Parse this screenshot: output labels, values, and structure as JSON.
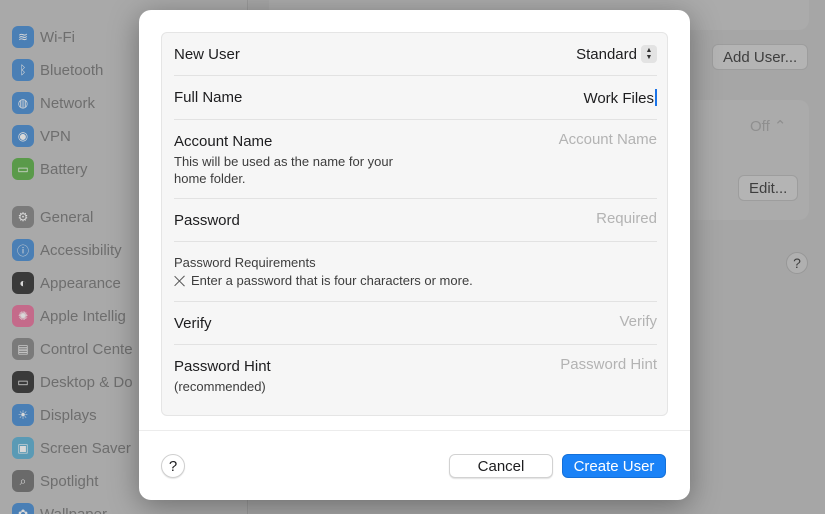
{
  "sidebar": {
    "items": [
      {
        "label": "Wi-Fi",
        "icon": "wifi-icon",
        "color": "#4a7fb5"
      },
      {
        "label": "Bluetooth",
        "icon": "bluetooth-icon",
        "color": "#4a7fb5"
      },
      {
        "label": "Network",
        "icon": "globe-icon",
        "color": "#4a7fb5"
      },
      {
        "label": "VPN",
        "icon": "vpn-icon",
        "color": "#4a7fb5"
      },
      {
        "label": "Battery",
        "icon": "battery-icon",
        "color": "#5a9a4a"
      },
      {
        "label": "General",
        "icon": "gear-icon",
        "color": "#7a7a7a"
      },
      {
        "label": "Accessibility",
        "icon": "accessibility-icon",
        "color": "#4a7fb5"
      },
      {
        "label": "Appearance",
        "icon": "appearance-icon",
        "color": "#3a3a3a"
      },
      {
        "label": "Apple Intellig",
        "icon": "sparkle-icon",
        "color": "#c46a8a"
      },
      {
        "label": "Control Cente",
        "icon": "control-center-icon",
        "color": "#7a7a7a"
      },
      {
        "label": "Desktop & Do",
        "icon": "dock-icon",
        "color": "#3a3a3a"
      },
      {
        "label": "Displays",
        "icon": "sun-icon",
        "color": "#4a7fb5"
      },
      {
        "label": "Screen Saver",
        "icon": "screensaver-icon",
        "color": "#5a9ab5"
      },
      {
        "label": "Spotlight",
        "icon": "magnifier-icon",
        "color": "#6a6a6a"
      },
      {
        "label": "Wallpaper",
        "icon": "wallpaper-icon",
        "color": "#4a7fb5"
      }
    ]
  },
  "background": {
    "add_user_label": "Add User...",
    "off_label": "Off",
    "edit_label": "Edit...",
    "help_label": "?"
  },
  "dialog": {
    "new_user": {
      "label": "New User",
      "value": "Standard"
    },
    "full_name": {
      "label": "Full Name",
      "value": "Work Files"
    },
    "account_name": {
      "label": "Account Name",
      "sub": "This will be used as the name for your home folder.",
      "placeholder": "Account Name"
    },
    "password": {
      "label": "Password",
      "placeholder": "Required"
    },
    "password_requirements": {
      "title": "Password Requirements",
      "item": "Enter a password that is four characters or more."
    },
    "verify": {
      "label": "Verify",
      "placeholder": "Verify"
    },
    "password_hint": {
      "label": "Password Hint",
      "sub": "(recommended)",
      "placeholder": "Password Hint"
    },
    "help_label": "?",
    "cancel_label": "Cancel",
    "create_label": "Create User"
  },
  "colors": {
    "accent": "#1a82f7"
  }
}
